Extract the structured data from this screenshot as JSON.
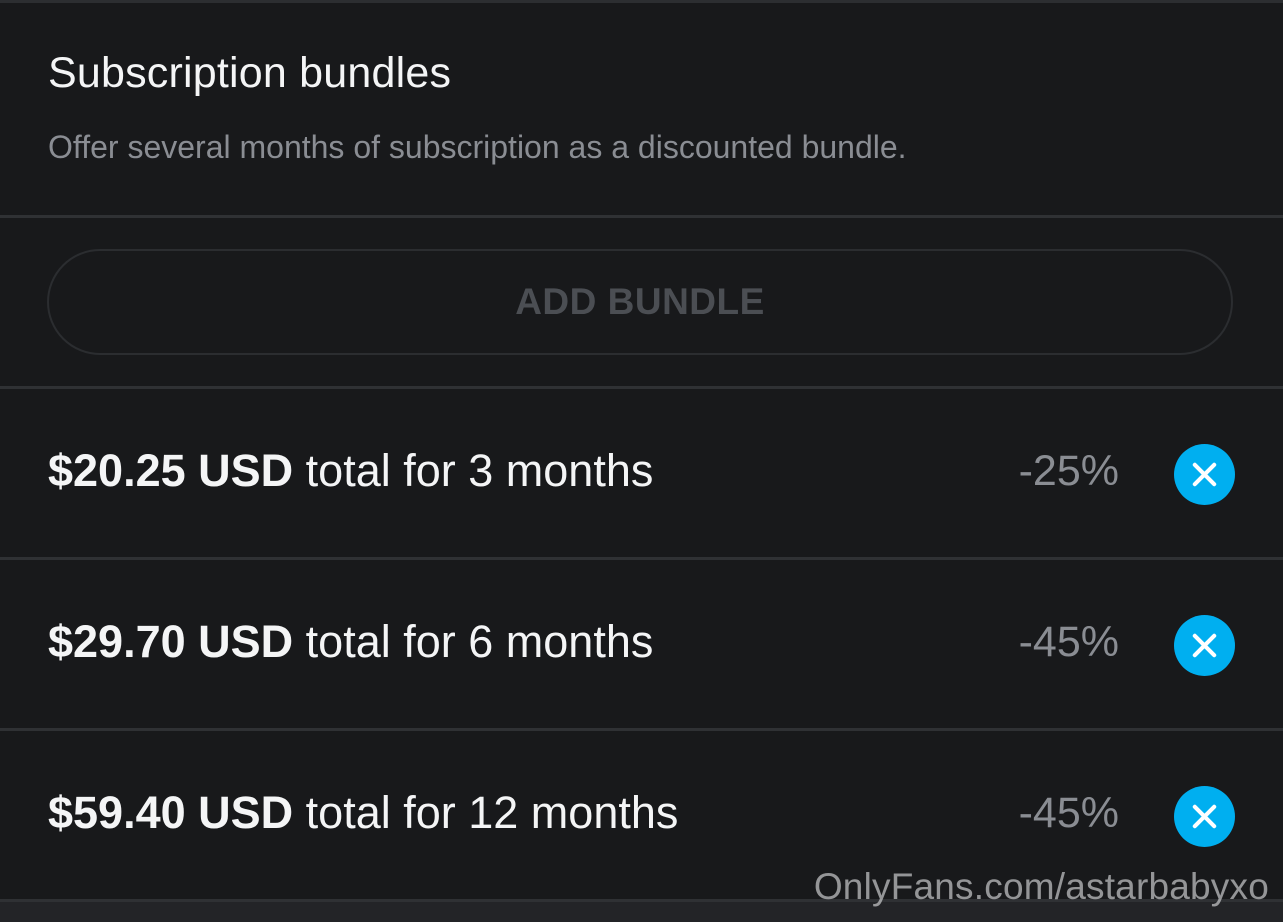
{
  "section": {
    "title": "Subscription bundles",
    "description": "Offer several months of subscription as a discounted bundle."
  },
  "add_button": {
    "label": "ADD BUNDLE"
  },
  "bundles": [
    {
      "price": "$20.25 USD",
      "duration": "total for 3 months",
      "discount": "-25%"
    },
    {
      "price": "$29.70 USD",
      "duration": "total for 6 months",
      "discount": "-45%"
    },
    {
      "price": "$59.40 USD",
      "duration": "total for 12 months",
      "discount": "-45%"
    }
  ],
  "watermark": "OnlyFans.com/astarbabyxo",
  "colors": {
    "background": "#18191b",
    "accent": "#00aff0",
    "primary_text": "#f4f5f6",
    "secondary_text": "#8a8d93",
    "disabled_text": "#4b4e53"
  },
  "icons": {
    "remove": "close-circle-icon"
  }
}
